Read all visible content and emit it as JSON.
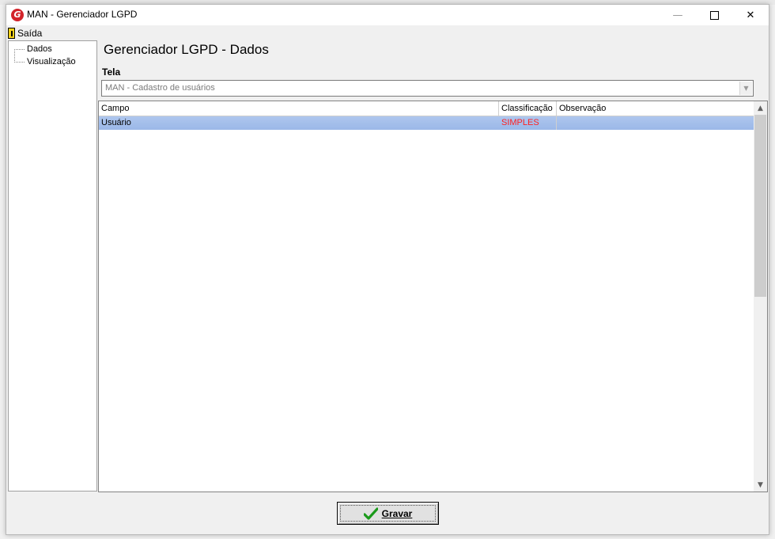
{
  "window": {
    "title": "MAN - Gerenciador LGPD",
    "min_glyph": "—",
    "close_glyph": "✕"
  },
  "menu": {
    "exit_label": "Saída"
  },
  "sidebar": {
    "items": [
      {
        "label": "Dados"
      },
      {
        "label": "Visualização"
      }
    ]
  },
  "main": {
    "title": "Gerenciador LGPD - Dados",
    "tela_label": "Tela",
    "tela_value": "MAN - Cadastro de usuários"
  },
  "grid": {
    "columns": [
      "Campo",
      "Classificação",
      "Observação"
    ],
    "rows": [
      {
        "campo": "Usuário",
        "classificacao": "SIMPLES",
        "observacao": ""
      }
    ]
  },
  "footer": {
    "save_label": "Gravar"
  },
  "colors": {
    "selected_row": "#aec6ee",
    "classification_text": "#ff1f1f",
    "brand_icon": "#d2232a"
  }
}
